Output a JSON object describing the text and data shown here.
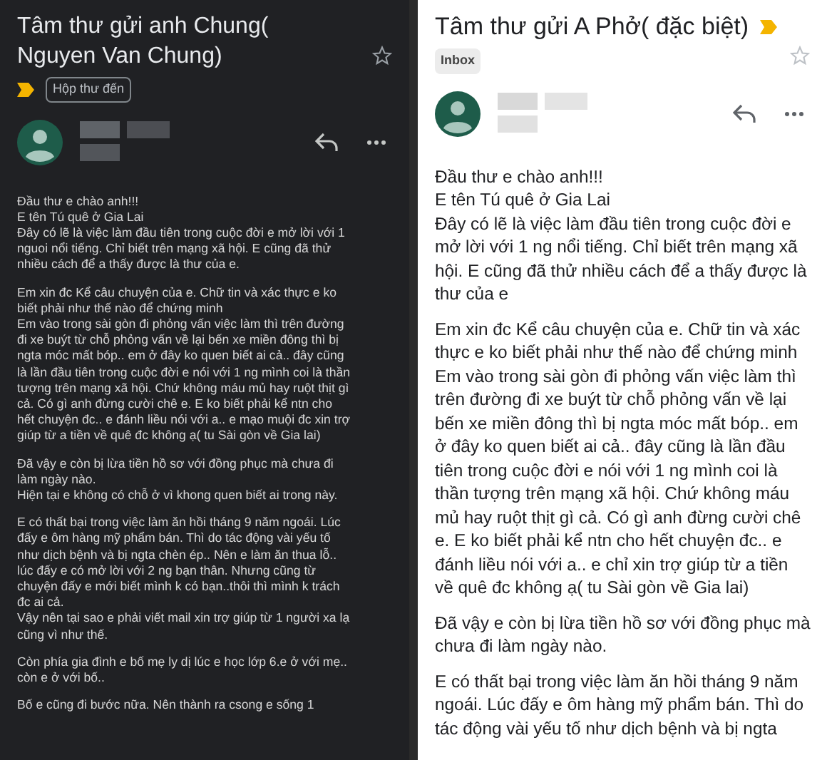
{
  "panels": [
    {
      "kind": "dark",
      "subject": "Tâm thư gửi anh Chung( Nguyen Van Chung)",
      "important": true,
      "label": "Hộp thư đến",
      "starred": false,
      "paragraphs": [
        [
          "Đầu thư e chào anh!!!",
          "E tên Tú quê ở Gia Lai",
          "Đây có lẽ là việc làm đầu tiên trong cuộc đời e mở lời với 1",
          "nguoi nổi tiếng. Chỉ biết trên mạng xã hội. E cũng đã thử",
          "nhiều cách để a thấy được là thư của e."
        ],
        [
          "Em xin đc Kể câu chuyện của e. Chữ tin và xác thực e ko",
          "biết phải như thế nào để chứng minh",
          "Em vào trong sài gòn đi phỏng vấn việc làm thì trên đường",
          "đi xe buýt từ chỗ phỏng vấn về lại bến xe miền đông thì bị",
          "ngta móc mất bóp.. em ở đây ko quen biết ai cả.. đây cũng",
          "là lần đầu tiên trong cuộc đời e nói với 1 ng mình coi là thần",
          "tượng trên mạng xã hội. Chứ không máu mủ hay ruột thịt gì",
          "cả. Có gì anh đừng cười chê e. E ko biết phải kể ntn cho",
          "hết chuyện đc.. e đánh liều nói với a.. e mạo muội đc xin trợ",
          "giúp từ a tiền về quê đc không ạ( tu Sài gòn về Gia lai)"
        ],
        [
          "Đã vậy e còn bị lừa tiền hồ sơ với đồng phục mà chưa đi",
          "làm ngày nào.",
          "Hiện tại e không có chỗ ở vì khong quen biết ai trong này."
        ],
        [
          "E có thất bại trong việc làm ăn hồi tháng 9 năm ngoái. Lúc",
          "đấy e ôm hàng mỹ phẩm bán. Thì do tác động vài yếu tố",
          "như dịch bệnh và bị ngta chèn ép.. Nên e làm ăn thua lỗ..",
          "lúc đấy e có mở lời với 2 ng bạn thân. Nhưng cũng từ",
          "chuyện đấy e mới biết mình k có bạn..thôi thì mình k trách",
          "đc ai cả.",
          "Vậy nên tại sao e phải viết mail xin trợ giúp từ 1 người xa lạ",
          "cũng vì như thế."
        ],
        [
          "Còn phía gia đình e bố mẹ ly dị lúc e học lớp 6.e ở với mẹ..",
          "còn e ở với bố.."
        ],
        [
          "Bố e cũng đi bước nữa. Nên thành ra csong e sống 1"
        ]
      ]
    },
    {
      "kind": "light",
      "subject": "Tâm thư gửi A Phở( đặc biệt)",
      "important": true,
      "label": "Inbox",
      "starred": false,
      "paragraphs": [
        [
          "Đầu thư e chào anh!!!",
          "E tên Tú quê ở Gia Lai",
          "Đây có lẽ là việc làm đầu tiên trong cuộc đời e",
          "mở lời với 1 ng nổi tiếng. Chỉ biết trên mạng xã",
          "hội. E cũng đã thử nhiều cách để a thấy được là",
          "thư của e"
        ],
        [
          "Em xin đc Kể câu chuyện của e. Chữ tin và xác",
          "thực e ko biết phải như thế nào để chứng minh",
          "Em vào trong sài gòn đi phỏng vấn việc làm thì",
          "trên đường đi xe buýt từ chỗ phỏng vấn về lại",
          "bến xe miền đông thì bị ngta móc mất bóp.. em",
          "ở đây ko quen biết ai cả.. đây cũng là lần đầu",
          "tiên trong cuộc đời e nói với 1 ng mình coi là",
          "thần tượng trên mạng xã hội. Chứ không máu",
          "mủ hay ruột thịt gì cả. Có gì anh đừng cười chê",
          "e. E ko biết phải kể ntn cho hết chuyện đc.. e",
          "đánh liều nói với a.. e chỉ xin trợ giúp từ a tiền",
          "về quê đc không ạ( tu Sài gòn về Gia lai)"
        ],
        [
          "Đã vậy e còn bị lừa tiền hồ sơ với đồng phục mà",
          "chưa đi làm ngày nào."
        ],
        [
          "E có thất bại trong việc làm ăn hồi tháng 9 năm",
          "ngoái. Lúc đấy e ôm hàng mỹ phẩm bán. Thì do",
          "tác động vài yếu tố như dịch bệnh và bị ngta"
        ]
      ]
    }
  ]
}
